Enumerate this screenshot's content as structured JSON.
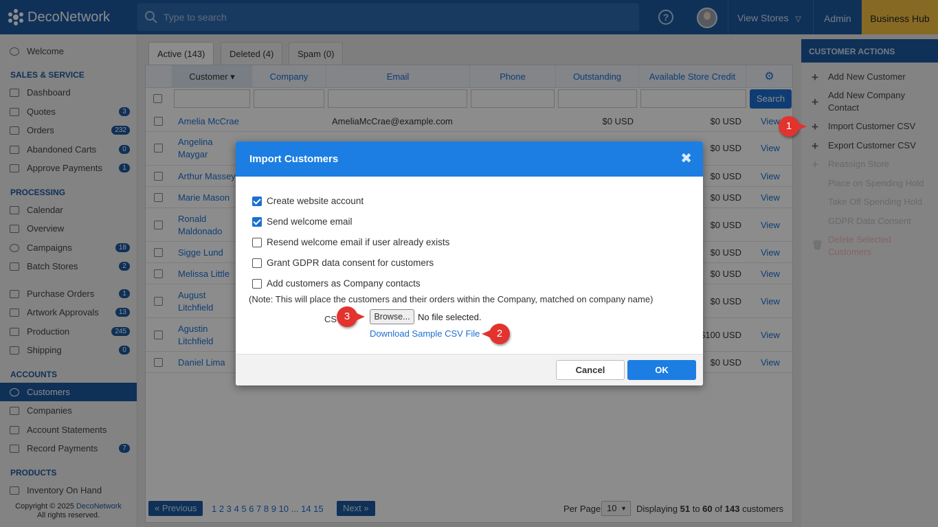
{
  "topbar": {
    "app_name": "DecoNetwork",
    "search_placeholder": "Type to search",
    "view_stores": "View Stores",
    "admin": "Admin",
    "business_hub": "Business Hub"
  },
  "sidebar": {
    "welcome": "Welcome",
    "sections": {
      "sales": "SALES & SERVICE",
      "processing": "PROCESSING",
      "accounts": "ACCOUNTS",
      "products": "PRODUCTS"
    },
    "items": {
      "dashboard": {
        "label": "Dashboard"
      },
      "quotes": {
        "label": "Quotes",
        "badge": "3"
      },
      "orders": {
        "label": "Orders",
        "badge": "232"
      },
      "abandoned": {
        "label": "Abandoned Carts",
        "badge": "0"
      },
      "approve": {
        "label": "Approve Payments",
        "badge": "1"
      },
      "calendar": {
        "label": "Calendar"
      },
      "overview": {
        "label": "Overview"
      },
      "campaigns": {
        "label": "Campaigns",
        "badge": "18"
      },
      "batch": {
        "label": "Batch Stores",
        "badge": "2"
      },
      "purchase": {
        "label": "Purchase Orders",
        "badge": "1"
      },
      "artwork": {
        "label": "Artwork Approvals",
        "badge": "13"
      },
      "production": {
        "label": "Production",
        "badge": "245"
      },
      "shipping": {
        "label": "Shipping",
        "badge": "0"
      },
      "customers": {
        "label": "Customers"
      },
      "companies": {
        "label": "Companies"
      },
      "statements": {
        "label": "Account Statements"
      },
      "record": {
        "label": "Record Payments",
        "badge": "7"
      },
      "inventory": {
        "label": "Inventory On Hand"
      }
    },
    "copyright": "Copyright © 2025",
    "copyright_link": "DecoNetwork",
    "rights": "All rights reserved."
  },
  "tabs": {
    "active": "Active (143)",
    "deleted": "Deleted (4)",
    "spam": "Spam (0)"
  },
  "table": {
    "headers": {
      "customer": "Customer ▾",
      "company": "Company",
      "email": "Email",
      "phone": "Phone",
      "outstanding": "Outstanding",
      "credit": "Available Store Credit"
    },
    "search_button": "Search",
    "view_label": "View",
    "rows": [
      {
        "name": "Amelia McCrae",
        "email": "AmeliaMcCrae@example.com",
        "outstanding": "$0 USD",
        "credit": "$0 USD",
        "view": "View"
      },
      {
        "name": "Angelina\nMaygar",
        "credit": "$0 USD",
        "view": "View"
      },
      {
        "name": "Arthur Massey",
        "credit": "$0 USD",
        "view": "View"
      },
      {
        "name": "Marie Mason",
        "credit": "$0 USD",
        "view": "View"
      },
      {
        "name": "Ronald\nMaldonado",
        "credit": "$0 USD",
        "view": "View"
      },
      {
        "name": "Sigge Lund",
        "credit": "$0 USD",
        "view": "View"
      },
      {
        "name": "Melissa Little",
        "credit": "$0 USD",
        "view": "View"
      },
      {
        "name": "August\nLitchfield",
        "credit": "$0 USD",
        "view": "View"
      },
      {
        "name": "Agustin\nLitchfield",
        "credit": "$100 USD",
        "view": "View"
      },
      {
        "name": "Daniel Lima",
        "credit": "$0 USD",
        "view": "View"
      }
    ]
  },
  "pager": {
    "previous": "« Previous",
    "pages": "1 2 3 4 5 6 7 8 9 10 ... 14 15",
    "next": "Next »",
    "per_page_label": "Per Page",
    "per_page_value": "10",
    "displaying_prefix": "Displaying",
    "from": "51",
    "to_word": "to",
    "to": "60",
    "of_word": "of",
    "total": "143",
    "suffix": "customers"
  },
  "actions": {
    "title": "CUSTOMER ACTIONS",
    "add_customer": "Add New Customer",
    "add_company_contact": "Add New Company Contact",
    "import_csv": "Import Customer CSV",
    "export_csv": "Export Customer CSV",
    "reassign": "Reassign Store",
    "place_hold": "Place on Spending Hold",
    "take_hold": "Take Off Spending Hold",
    "gdpr": "GDPR Data Consent",
    "delete": "Delete Selected Customers"
  },
  "modal": {
    "title": "Import Customers",
    "options": {
      "create_account": {
        "label": "Create website account",
        "checked": true
      },
      "send_welcome": {
        "label": "Send welcome email",
        "checked": true
      },
      "resend_welcome": {
        "label": "Resend welcome email if user already exists",
        "checked": false
      },
      "gdpr_consent": {
        "label": "Grant GDPR data consent for customers",
        "checked": false
      },
      "company_contacts": {
        "label": "Add customers as Company contacts",
        "checked": false
      }
    },
    "note": "(Note: This will place the customers and their orders within the Company, matched on company name)",
    "csv_label": "CS",
    "browse": "Browse...",
    "no_file": "No file selected.",
    "download_link": "Download Sample CSV File",
    "cancel": "Cancel",
    "ok": "OK"
  },
  "callouts": {
    "one": "1",
    "two": "2",
    "three": "3"
  },
  "colors": {
    "brand": "#1c5aa0",
    "accent": "#1c7ee3",
    "business_hub": "#f5c242",
    "callout": "#e2332f"
  }
}
